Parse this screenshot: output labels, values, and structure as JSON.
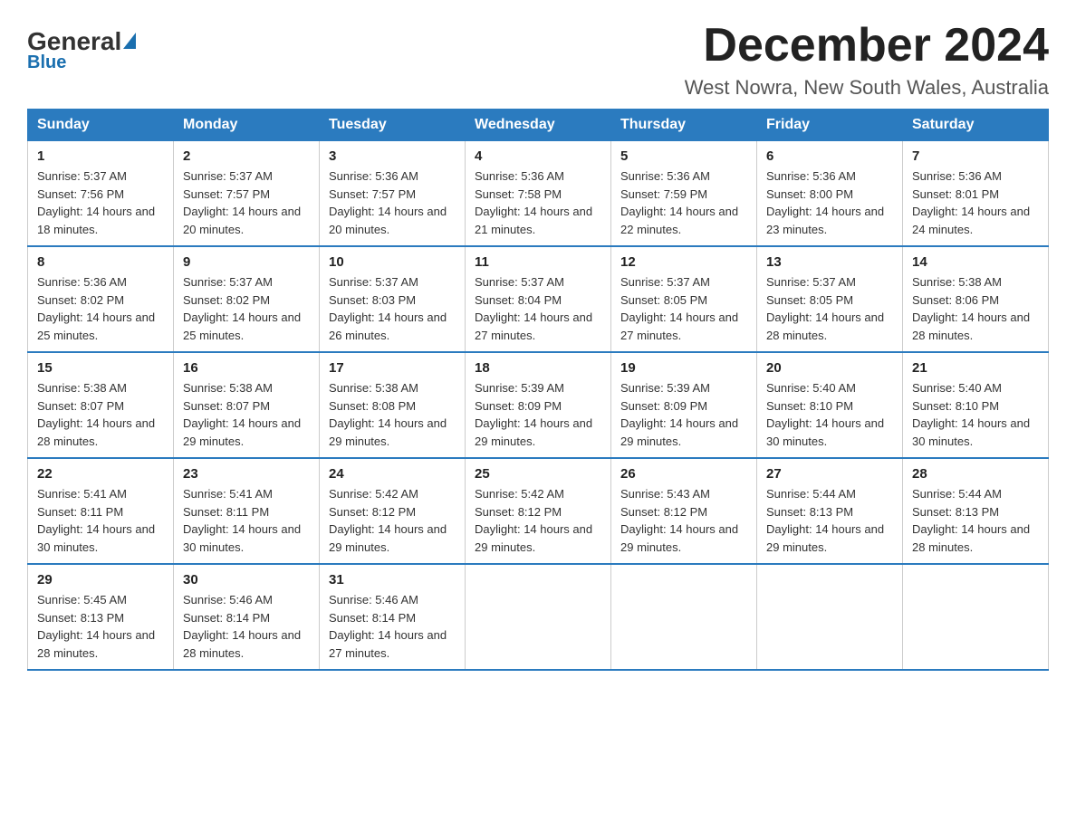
{
  "logo": {
    "general": "General",
    "triangle": "",
    "blue": "Blue"
  },
  "header": {
    "month_title": "December 2024",
    "location": "West Nowra, New South Wales, Australia"
  },
  "days_of_week": [
    "Sunday",
    "Monday",
    "Tuesday",
    "Wednesday",
    "Thursday",
    "Friday",
    "Saturday"
  ],
  "weeks": [
    [
      {
        "day": "1",
        "sunrise": "5:37 AM",
        "sunset": "7:56 PM",
        "daylight": "14 hours and 18 minutes."
      },
      {
        "day": "2",
        "sunrise": "5:37 AM",
        "sunset": "7:57 PM",
        "daylight": "14 hours and 20 minutes."
      },
      {
        "day": "3",
        "sunrise": "5:36 AM",
        "sunset": "7:57 PM",
        "daylight": "14 hours and 20 minutes."
      },
      {
        "day": "4",
        "sunrise": "5:36 AM",
        "sunset": "7:58 PM",
        "daylight": "14 hours and 21 minutes."
      },
      {
        "day": "5",
        "sunrise": "5:36 AM",
        "sunset": "7:59 PM",
        "daylight": "14 hours and 22 minutes."
      },
      {
        "day": "6",
        "sunrise": "5:36 AM",
        "sunset": "8:00 PM",
        "daylight": "14 hours and 23 minutes."
      },
      {
        "day": "7",
        "sunrise": "5:36 AM",
        "sunset": "8:01 PM",
        "daylight": "14 hours and 24 minutes."
      }
    ],
    [
      {
        "day": "8",
        "sunrise": "5:36 AM",
        "sunset": "8:02 PM",
        "daylight": "14 hours and 25 minutes."
      },
      {
        "day": "9",
        "sunrise": "5:37 AM",
        "sunset": "8:02 PM",
        "daylight": "14 hours and 25 minutes."
      },
      {
        "day": "10",
        "sunrise": "5:37 AM",
        "sunset": "8:03 PM",
        "daylight": "14 hours and 26 minutes."
      },
      {
        "day": "11",
        "sunrise": "5:37 AM",
        "sunset": "8:04 PM",
        "daylight": "14 hours and 27 minutes."
      },
      {
        "day": "12",
        "sunrise": "5:37 AM",
        "sunset": "8:05 PM",
        "daylight": "14 hours and 27 minutes."
      },
      {
        "day": "13",
        "sunrise": "5:37 AM",
        "sunset": "8:05 PM",
        "daylight": "14 hours and 28 minutes."
      },
      {
        "day": "14",
        "sunrise": "5:38 AM",
        "sunset": "8:06 PM",
        "daylight": "14 hours and 28 minutes."
      }
    ],
    [
      {
        "day": "15",
        "sunrise": "5:38 AM",
        "sunset": "8:07 PM",
        "daylight": "14 hours and 28 minutes."
      },
      {
        "day": "16",
        "sunrise": "5:38 AM",
        "sunset": "8:07 PM",
        "daylight": "14 hours and 29 minutes."
      },
      {
        "day": "17",
        "sunrise": "5:38 AM",
        "sunset": "8:08 PM",
        "daylight": "14 hours and 29 minutes."
      },
      {
        "day": "18",
        "sunrise": "5:39 AM",
        "sunset": "8:09 PM",
        "daylight": "14 hours and 29 minutes."
      },
      {
        "day": "19",
        "sunrise": "5:39 AM",
        "sunset": "8:09 PM",
        "daylight": "14 hours and 29 minutes."
      },
      {
        "day": "20",
        "sunrise": "5:40 AM",
        "sunset": "8:10 PM",
        "daylight": "14 hours and 30 minutes."
      },
      {
        "day": "21",
        "sunrise": "5:40 AM",
        "sunset": "8:10 PM",
        "daylight": "14 hours and 30 minutes."
      }
    ],
    [
      {
        "day": "22",
        "sunrise": "5:41 AM",
        "sunset": "8:11 PM",
        "daylight": "14 hours and 30 minutes."
      },
      {
        "day": "23",
        "sunrise": "5:41 AM",
        "sunset": "8:11 PM",
        "daylight": "14 hours and 30 minutes."
      },
      {
        "day": "24",
        "sunrise": "5:42 AM",
        "sunset": "8:12 PM",
        "daylight": "14 hours and 29 minutes."
      },
      {
        "day": "25",
        "sunrise": "5:42 AM",
        "sunset": "8:12 PM",
        "daylight": "14 hours and 29 minutes."
      },
      {
        "day": "26",
        "sunrise": "5:43 AM",
        "sunset": "8:12 PM",
        "daylight": "14 hours and 29 minutes."
      },
      {
        "day": "27",
        "sunrise": "5:44 AM",
        "sunset": "8:13 PM",
        "daylight": "14 hours and 29 minutes."
      },
      {
        "day": "28",
        "sunrise": "5:44 AM",
        "sunset": "8:13 PM",
        "daylight": "14 hours and 28 minutes."
      }
    ],
    [
      {
        "day": "29",
        "sunrise": "5:45 AM",
        "sunset": "8:13 PM",
        "daylight": "14 hours and 28 minutes."
      },
      {
        "day": "30",
        "sunrise": "5:46 AM",
        "sunset": "8:14 PM",
        "daylight": "14 hours and 28 minutes."
      },
      {
        "day": "31",
        "sunrise": "5:46 AM",
        "sunset": "8:14 PM",
        "daylight": "14 hours and 27 minutes."
      },
      null,
      null,
      null,
      null
    ]
  ]
}
